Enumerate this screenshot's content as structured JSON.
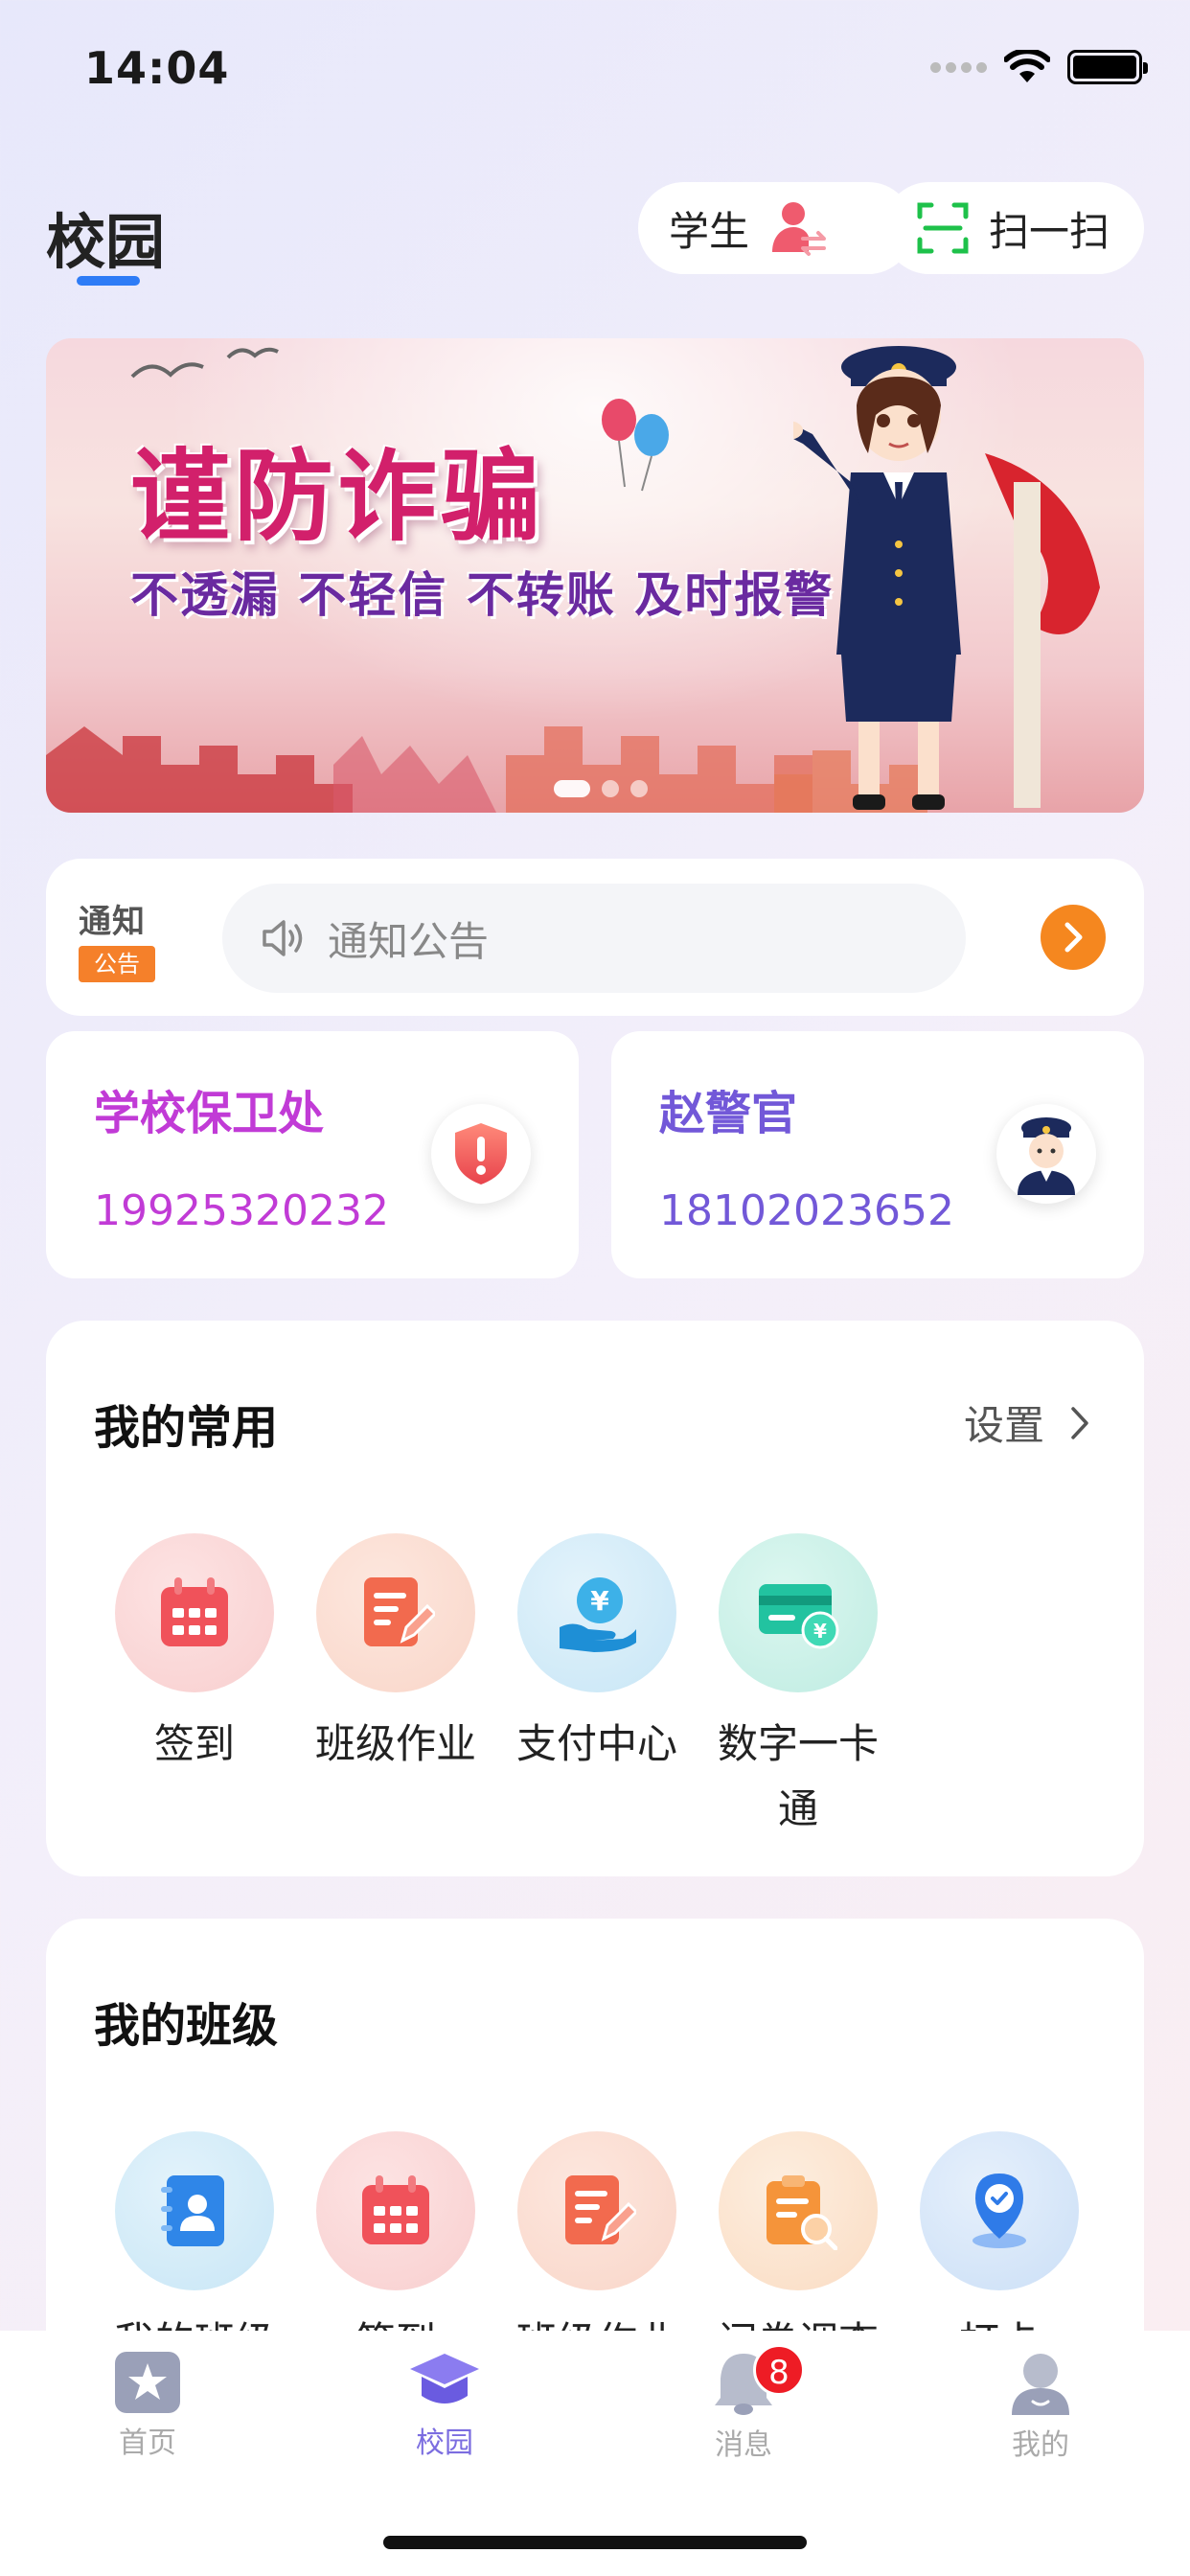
{
  "status_bar": {
    "time": "14:04"
  },
  "header": {
    "title": "校园",
    "role_label": "学生",
    "scan_label": "扫一扫"
  },
  "banner": {
    "title": "谨防诈骗",
    "subtitle": "不透漏 不轻信 不转账 及时报警"
  },
  "notice": {
    "logo_top": "通知",
    "logo_tag": "公告",
    "placeholder": "通知公告"
  },
  "contacts": [
    {
      "name": "学校保卫处",
      "phone": "19925320232",
      "icon": "shield-alert-icon"
    },
    {
      "name": "赵警官",
      "phone": "18102023652",
      "icon": "police-avatar-icon"
    }
  ],
  "common": {
    "title": "我的常用",
    "settings_label": "设置",
    "items": [
      {
        "label": "签到",
        "icon": "calendar-icon"
      },
      {
        "label": "班级作业",
        "icon": "homework-icon"
      },
      {
        "label": "支付中心",
        "icon": "payment-icon"
      },
      {
        "label": "数字一卡通",
        "icon": "card-icon"
      }
    ]
  },
  "my_class": {
    "title": "我的班级",
    "items": [
      {
        "label": "我的班级",
        "icon": "contacts-book-icon"
      },
      {
        "label": "签到",
        "icon": "calendar-icon"
      },
      {
        "label": "班级作业",
        "icon": "homework-icon"
      },
      {
        "label": "问卷调查",
        "icon": "survey-icon"
      },
      {
        "label": "打卡",
        "icon": "location-check-icon"
      }
    ]
  },
  "tabbar": {
    "items": [
      {
        "label": "首页",
        "icon": "home-star-icon",
        "active": false
      },
      {
        "label": "校园",
        "icon": "graduation-cap-icon",
        "active": true
      },
      {
        "label": "消息",
        "icon": "bell-icon",
        "active": false,
        "badge": "8"
      },
      {
        "label": "我的",
        "icon": "profile-icon",
        "active": false
      }
    ]
  },
  "colors": {
    "accent_blue": "#2e7cf6",
    "tab_active": "#7b6de0",
    "notice_orange": "#f5871f",
    "badge_red": "#ee1c25"
  }
}
